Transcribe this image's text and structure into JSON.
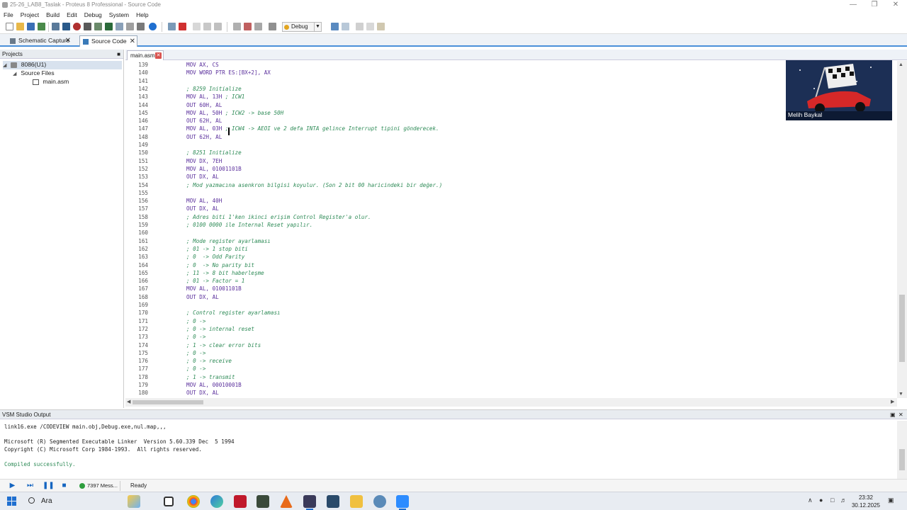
{
  "window": {
    "title": "25-26_LAB8_Taslak - Proteus 8 Professional - Source Code"
  },
  "menu": [
    "File",
    "Project",
    "Build",
    "Edit",
    "Debug",
    "System",
    "Help"
  ],
  "toolbar": {
    "config_select": "Debug"
  },
  "doc_tabs": [
    {
      "label": "Schematic Capture",
      "active": false
    },
    {
      "label": "Source Code",
      "active": true
    }
  ],
  "projects": {
    "header": "Projects",
    "tree": [
      {
        "label": "8086(U1)",
        "level": 0
      },
      {
        "label": "Source Files",
        "level": 1
      },
      {
        "label": "main.asm",
        "level": 2
      }
    ]
  },
  "editor": {
    "tab_label": "main.asm",
    "lines": [
      {
        "num": "139",
        "code": "MOV AX, CS",
        "type": "code"
      },
      {
        "num": "140",
        "code": "MOV WORD PTR ES:[BX+2], AX",
        "type": "code"
      },
      {
        "num": "141",
        "code": "",
        "type": "code"
      },
      {
        "num": "142",
        "code": "; 8259 Initialize",
        "type": "comment"
      },
      {
        "num": "143",
        "code": "MOV AL, 13H",
        "comment": " ; ICW1",
        "type": "mixed"
      },
      {
        "num": "144",
        "code": "OUT 60H, AL",
        "type": "code"
      },
      {
        "num": "145",
        "code": "MOV AL, 50H",
        "comment": " ; ICW2 -> base 50H",
        "type": "mixed"
      },
      {
        "num": "146",
        "code": "OUT 62H, AL",
        "type": "code"
      },
      {
        "num": "147",
        "code": "MOV AL, 03H",
        "comment": " ; ICW4 -> AEOI ve 2 defa INTA gelince Interrupt tipini gönderecek.",
        "type": "mixed"
      },
      {
        "num": "148",
        "code": "OUT 62H, AL",
        "type": "code"
      },
      {
        "num": "149",
        "code": "",
        "type": "code"
      },
      {
        "num": "150",
        "code": "; 8251 Initialize",
        "type": "comment"
      },
      {
        "num": "151",
        "code": "MOV DX, 7EH",
        "type": "code"
      },
      {
        "num": "152",
        "code": "MOV AL, 01001101B",
        "type": "code"
      },
      {
        "num": "153",
        "code": "OUT DX, AL",
        "type": "code"
      },
      {
        "num": "154",
        "code": "; Mod yazmacına asenkron bilgisi koyulur. (Son 2 bit 00 haricindeki bir değer.)",
        "type": "comment"
      },
      {
        "num": "155",
        "code": "",
        "type": "code"
      },
      {
        "num": "156",
        "code": "MOV AL, 40H",
        "type": "code"
      },
      {
        "num": "157",
        "code": "OUT DX, AL",
        "type": "code"
      },
      {
        "num": "158",
        "code": "; Adres biti 1'ken ikinci erişim Control Register'a olur.",
        "type": "comment"
      },
      {
        "num": "159",
        "code": "; 0100 0000 ile Internal Reset yapılır.",
        "type": "comment"
      },
      {
        "num": "160",
        "code": "",
        "type": "code"
      },
      {
        "num": "161",
        "code": "; Mode register ayarlaması",
        "type": "comment"
      },
      {
        "num": "162",
        "code": "; 01 -> 1 stop biti",
        "type": "comment"
      },
      {
        "num": "163",
        "code": "; 0  -> Odd Parity",
        "type": "comment"
      },
      {
        "num": "164",
        "code": "; 0  -> No parity bit",
        "type": "comment"
      },
      {
        "num": "165",
        "code": "; 11 -> 8 bit haberleşme",
        "type": "comment"
      },
      {
        "num": "166",
        "code": "; 01 -> Factor = 1",
        "type": "comment"
      },
      {
        "num": "167",
        "code": "MOV AL, 01001101B",
        "type": "code"
      },
      {
        "num": "168",
        "code": "OUT DX, AL",
        "type": "code"
      },
      {
        "num": "169",
        "code": "",
        "type": "code"
      },
      {
        "num": "170",
        "code": "; Control register ayarlaması",
        "type": "comment"
      },
      {
        "num": "171",
        "code": "; 0 ->",
        "type": "comment"
      },
      {
        "num": "172",
        "code": "; 0 -> internal reset",
        "type": "comment"
      },
      {
        "num": "173",
        "code": "; 0 ->",
        "type": "comment"
      },
      {
        "num": "174",
        "code": "; 1 -> clear error bits",
        "type": "comment"
      },
      {
        "num": "175",
        "code": "; 0 ->",
        "type": "comment"
      },
      {
        "num": "176",
        "code": "; 0 -> receive",
        "type": "comment"
      },
      {
        "num": "177",
        "code": "; 0 ->",
        "type": "comment"
      },
      {
        "num": "178",
        "code": "; 1 -> transmit",
        "type": "comment"
      },
      {
        "num": "179",
        "code": "MOV AL, 00010001B",
        "type": "code"
      },
      {
        "num": "180",
        "code": "OUT DX, AL",
        "type": "code"
      }
    ]
  },
  "output": {
    "header": "VSM Studio Output",
    "lines": [
      {
        "text": "link16.exe /CODEVIEW main.obj,Debug.exe,nul.map,,,",
        "ok": false
      },
      {
        "text": "",
        "ok": false
      },
      {
        "text": "Microsoft (R) Segmented Executable Linker  Version 5.60.339 Dec  5 1994",
        "ok": false
      },
      {
        "text": "Copyright (C) Microsoft Corp 1984-1993.  All rights reserved.",
        "ok": false
      },
      {
        "text": "",
        "ok": false
      },
      {
        "text": "Compiled successfully.",
        "ok": true
      }
    ]
  },
  "status": {
    "messages": "7397 Mess...",
    "state": "Ready"
  },
  "webcam": {
    "name": "Melih Baykal"
  },
  "taskbar": {
    "search_label": "Ara",
    "time": "23:32",
    "date": "30.12.2025"
  }
}
